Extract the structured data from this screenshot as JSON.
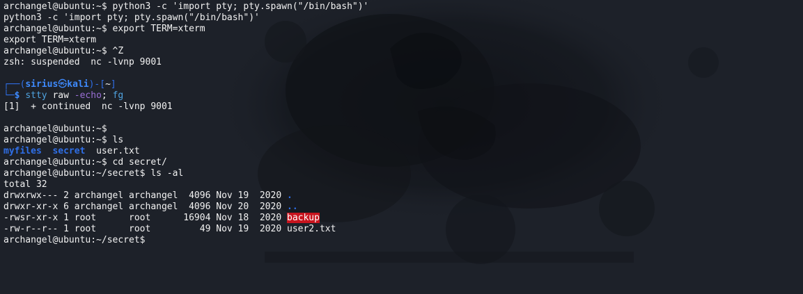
{
  "terminal": {
    "lines": [
      {
        "segments": [
          {
            "text": "archangel@ubuntu:~$ python3 -c 'import pty; pty.spawn(\"/bin/bash\")'",
            "style": "normal"
          }
        ]
      },
      {
        "segments": [
          {
            "text": "python3 -c 'import pty; pty.spawn(\"/bin/bash\")'",
            "style": "normal"
          }
        ]
      },
      {
        "segments": [
          {
            "text": "archangel@ubuntu:~$ export TERM=xterm",
            "style": "normal"
          }
        ]
      },
      {
        "segments": [
          {
            "text": "export TERM=xterm",
            "style": "normal"
          }
        ]
      },
      {
        "segments": [
          {
            "text": "archangel@ubuntu:~$ ^Z",
            "style": "normal"
          }
        ]
      },
      {
        "segments": [
          {
            "text": "zsh: suspended  nc -lvnp 9001",
            "style": "normal"
          }
        ]
      },
      {
        "segments": [
          {
            "text": "",
            "style": "normal"
          }
        ]
      },
      {
        "segments": [
          {
            "text": "┌──(",
            "style": "prompt-structure"
          },
          {
            "text": "sirius",
            "style": "prompt-user"
          },
          {
            "text": "㉿",
            "style": "prompt-skull"
          },
          {
            "text": "kali",
            "style": "prompt-user"
          },
          {
            "text": ")-[",
            "style": "prompt-structure"
          },
          {
            "text": "~",
            "style": "prompt-path"
          },
          {
            "text": "]",
            "style": "prompt-structure"
          }
        ]
      },
      {
        "segments": [
          {
            "text": "└─",
            "style": "prompt-structure"
          },
          {
            "text": "$ ",
            "style": "prompt-user"
          },
          {
            "text": "stty",
            "style": "command"
          },
          {
            "text": " raw ",
            "style": "normal"
          },
          {
            "text": "-echo",
            "style": "flag"
          },
          {
            "text": "; ",
            "style": "normal"
          },
          {
            "text": "fg",
            "style": "command"
          }
        ]
      },
      {
        "segments": [
          {
            "text": "[1]  + continued  nc -lvnp 9001",
            "style": "normal"
          }
        ]
      },
      {
        "segments": [
          {
            "text": "",
            "style": "normal"
          }
        ]
      },
      {
        "segments": [
          {
            "text": "archangel@ubuntu:~$ ",
            "style": "normal"
          }
        ]
      },
      {
        "segments": [
          {
            "text": "archangel@ubuntu:~$ ls",
            "style": "normal"
          }
        ]
      },
      {
        "segments": [
          {
            "text": "myfiles",
            "style": "directory"
          },
          {
            "text": "  ",
            "style": "normal"
          },
          {
            "text": "secret",
            "style": "directory"
          },
          {
            "text": "  user.txt",
            "style": "normal"
          }
        ]
      },
      {
        "segments": [
          {
            "text": "archangel@ubuntu:~$ cd secret/",
            "style": "normal"
          }
        ]
      },
      {
        "segments": [
          {
            "text": "archangel@ubuntu:~/secret$ ls -al",
            "style": "normal"
          }
        ]
      },
      {
        "segments": [
          {
            "text": "total 32",
            "style": "normal"
          }
        ]
      },
      {
        "segments": [
          {
            "text": "drwxrwx--- 2 archangel archangel  4096 Nov 19  2020 ",
            "style": "normal"
          },
          {
            "text": ".",
            "style": "directory"
          }
        ]
      },
      {
        "segments": [
          {
            "text": "drwxr-xr-x 6 archangel archangel  4096 Nov 20  2020 ",
            "style": "normal"
          },
          {
            "text": "..",
            "style": "directory"
          }
        ]
      },
      {
        "segments": [
          {
            "text": "-rwsr-xr-x 1 root      root      16904 Nov 18  2020 ",
            "style": "normal"
          },
          {
            "text": "backup",
            "style": "highlight"
          }
        ]
      },
      {
        "segments": [
          {
            "text": "-rw-r--r-- 1 root      root         49 Nov 19  2020 user2.txt",
            "style": "normal"
          }
        ]
      },
      {
        "segments": [
          {
            "text": "archangel@ubuntu:~/secret$ ",
            "style": "normal"
          }
        ]
      }
    ]
  },
  "colors": {
    "background": "#1d2129",
    "foreground": "#f2f2f2",
    "prompt_blue": "#2f6fe8",
    "command": "#4fa3e0",
    "flag": "#9a6fd6",
    "setuid_highlight": "#c8141e"
  }
}
